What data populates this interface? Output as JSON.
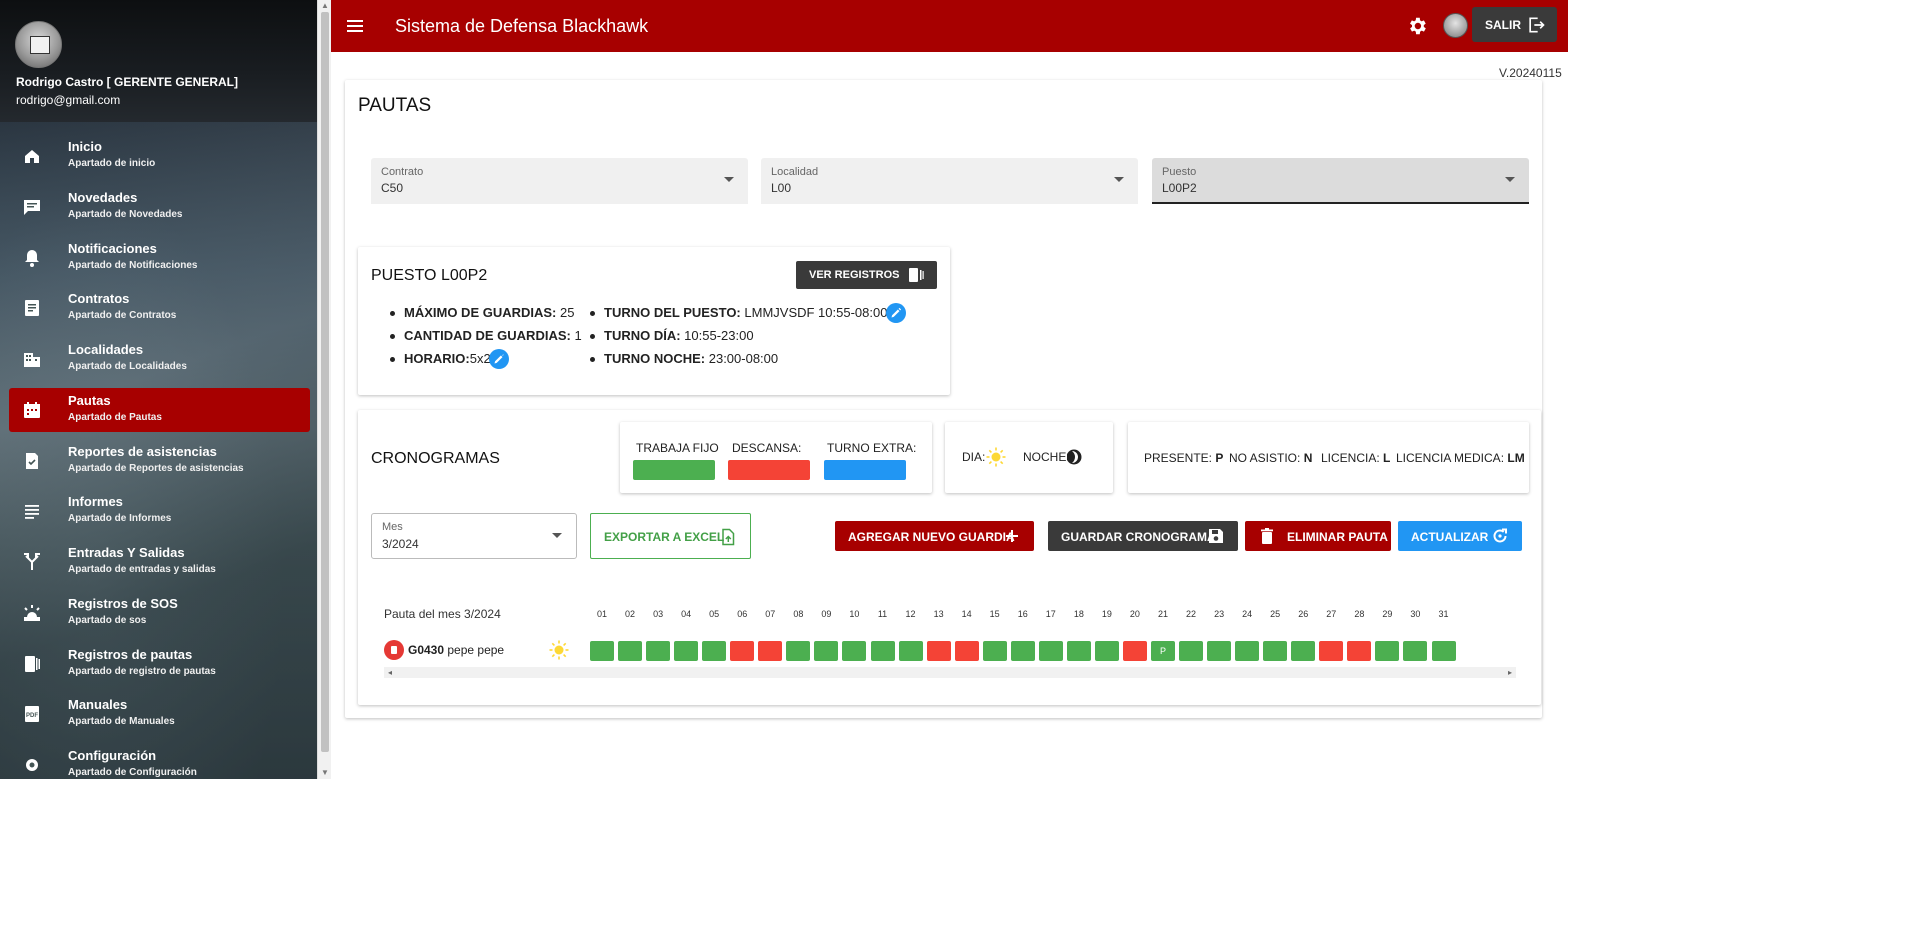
{
  "user": {
    "name": "Rodrigo Castro [ GERENTE GENERAL]",
    "email": "rodrigo@gmail.com"
  },
  "nav": [
    {
      "title": "Inicio",
      "sub": "Apartado de inicio",
      "icon": "home-icon"
    },
    {
      "title": "Novedades",
      "sub": "Apartado de Novedades",
      "icon": "message-icon"
    },
    {
      "title": "Notificaciones",
      "sub": "Apartado de Notificaciones",
      "icon": "bell-icon"
    },
    {
      "title": "Contratos",
      "sub": "Apartado de Contratos",
      "icon": "document-icon"
    },
    {
      "title": "Localidades",
      "sub": "Apartado de Localidades",
      "icon": "building-icon"
    },
    {
      "title": "Pautas",
      "sub": "Apartado de Pautas",
      "icon": "calendar-icon",
      "active": true
    },
    {
      "title": "Reportes de asistencias",
      "sub": "Apartado de Reportes de asistencias",
      "icon": "report-check-icon"
    },
    {
      "title": "Informes",
      "sub": "Apartado de Informes",
      "icon": "lines-icon"
    },
    {
      "title": "Entradas Y Salidas",
      "sub": "Apartado de entradas y salidas",
      "icon": "merge-arrows-icon"
    },
    {
      "title": "Registros de SOS",
      "sub": "Apartado de sos",
      "icon": "sos-icon"
    },
    {
      "title": "Registros de pautas",
      "sub": "Apartado de registro de pautas",
      "icon": "book-icon"
    },
    {
      "title": "Manuales",
      "sub": "Apartado de Manuales",
      "icon": "pdf-icon"
    },
    {
      "title": "Configuración",
      "sub": "Apartado de Configuración",
      "icon": "gear-icon"
    }
  ],
  "topbar": {
    "title": "Sistema de Defensa Blackhawk",
    "logout_label": "SALIR"
  },
  "version": "V.20240115",
  "page": {
    "title": "PAUTAS"
  },
  "filters": {
    "contrato": {
      "label": "Contrato",
      "value": "C50"
    },
    "localidad": {
      "label": "Localidad",
      "value": "L00"
    },
    "puesto": {
      "label": "Puesto",
      "value": "L00P2"
    }
  },
  "puesto": {
    "title": "PUESTO L00P2",
    "ver_registros": "VER REGISTROS",
    "max_guardias_key": "MÁXIMO DE GUARDIAS:",
    "max_guardias": "25",
    "cant_guardias_key": "CANTIDAD DE GUARDIAS:",
    "cant_guardias": "1",
    "horario_key": "HORARIO:",
    "horario": "5x2",
    "turno_puesto_key": "TURNO DEL PUESTO:",
    "turno_puesto": "LMMJVSDF 10:55-08:00",
    "turno_dia_key": "TURNO DÍA:",
    "turno_dia": "10:55-23:00",
    "turno_noche_key": "TURNO NOCHE:",
    "turno_noche": "23:00-08:00"
  },
  "crono": {
    "title": "CRONOGRAMAS",
    "legend": {
      "fijo": "TRABAJA FIJO",
      "descansa": "DESCANSA:",
      "extra": "TURNO EXTRA:",
      "dia": "DIA:",
      "noche": "NOCHE:"
    },
    "status_legend": {
      "presente_label": "PRESENTE:",
      "presente_code": "P",
      "no_asistio_label": "NO ASISTIO:",
      "no_asistio_code": "N",
      "licencia_label": "LICENCIA:",
      "licencia_code": "L",
      "licencia_medica_label": "LICENCIA MEDICA:",
      "licencia_medica_code": "LM"
    },
    "colors": {
      "fijo": "#4caf50",
      "descansa": "#f44336",
      "extra": "#2196f3"
    },
    "mes": {
      "label": "Mes",
      "value": "3/2024"
    },
    "buttons": {
      "exportar": "EXPORTAR A EXCEL",
      "agregar": "AGREGAR NUEVO GUARDIA",
      "guardar": "GUARDAR CRONOGRAMA",
      "eliminar": "ELIMINAR PAUTA",
      "actualizar": "ACTUALIZAR"
    },
    "pauta_label": "Pauta del mes 3/2024",
    "days": [
      "01",
      "02",
      "03",
      "04",
      "05",
      "06",
      "07",
      "08",
      "09",
      "10",
      "11",
      "12",
      "13",
      "14",
      "15",
      "16",
      "17",
      "18",
      "19",
      "20",
      "21",
      "22",
      "23",
      "24",
      "25",
      "26",
      "27",
      "28",
      "29",
      "30",
      "31"
    ],
    "guard": {
      "code": "G0430",
      "name": "pepe pepe",
      "schedule": [
        "W",
        "W",
        "W",
        "W",
        "W",
        "R",
        "R",
        "W",
        "W",
        "W",
        "W",
        "W",
        "R",
        "R",
        "W",
        "W",
        "W",
        "W",
        "W",
        "R",
        "P",
        "W",
        "W",
        "W",
        "W",
        "W",
        "R",
        "R",
        "W",
        "W",
        "W"
      ]
    }
  }
}
